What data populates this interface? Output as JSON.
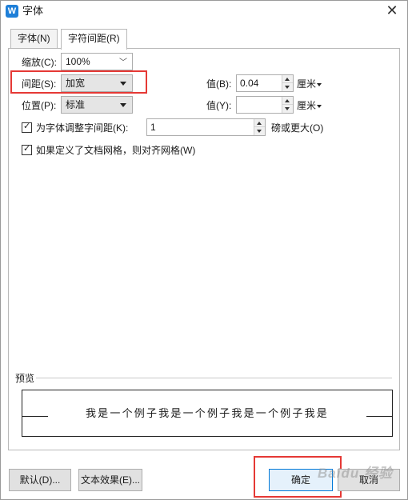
{
  "titlebar": {
    "title": "字体",
    "app_icon_letter": "W",
    "close_glyph": "✕"
  },
  "tabs": [
    {
      "label": "字体(N)",
      "active": false
    },
    {
      "label": "字符间距(R)",
      "active": true
    }
  ],
  "form": {
    "scale": {
      "label": "缩放(C):",
      "value": "100%"
    },
    "spacing": {
      "label": "间距(S):",
      "value": "加宽",
      "value_label": "值(B):",
      "value_input": "0.04",
      "unit": "厘米"
    },
    "position": {
      "label": "位置(P):",
      "value": "标准",
      "value_label": "值(Y):",
      "value_input": "",
      "unit": "厘米"
    },
    "kerning": {
      "label": "为字体调整字间距(K):",
      "checked": true,
      "value": "1",
      "suffix": "磅或更大(O)"
    },
    "grid": {
      "label": "如果定义了文档网格，则对齐网格(W)",
      "checked": true
    }
  },
  "preview": {
    "label": "预览",
    "text": "我是一个例子我是一个例子我是一个例子我是"
  },
  "buttons": {
    "default": "默认(D)...",
    "text_effects": "文本效果(E)...",
    "ok": "确定",
    "cancel": "取消"
  },
  "watermark": "Baidu 经验",
  "colors": {
    "highlight": "#e53935",
    "primary_border": "#0078d7",
    "app_icon": "#1e7fd8"
  }
}
